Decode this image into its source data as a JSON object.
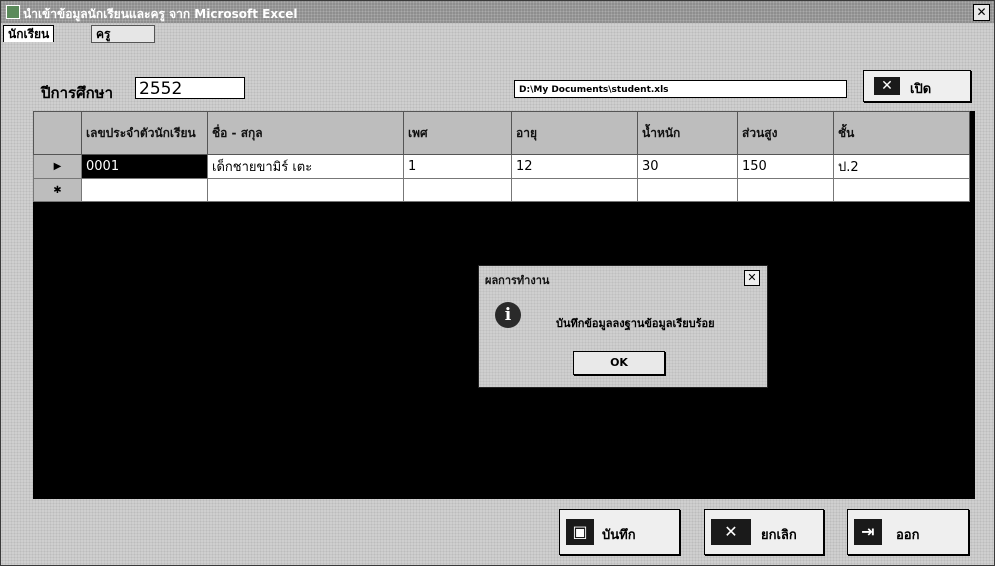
{
  "window": {
    "title": "นำเข้าข้อมูลนักเรียนและครู จาก Microsoft Excel",
    "close_symbol": "✕"
  },
  "tabs": [
    {
      "label": "นักเรียน",
      "active": true
    },
    {
      "label": "ครู",
      "active": false
    }
  ],
  "form": {
    "year_label": "ปีการศึกษา",
    "year_value": "2552",
    "file_path": "D:\\My Documents\\student.xls",
    "open_label": "เปิด",
    "excel_icon_glyph": "✕"
  },
  "grid": {
    "columns": [
      "เลขประจำตัวนักเรียน",
      "ชื่อ - สกุล",
      "เพศ",
      "อายุ",
      "น้ำหนัก",
      "ส่วนสูง",
      "ชั้น"
    ],
    "rows": [
      {
        "indicator": "▶",
        "cells": [
          "0001",
          "เด็กชายขามิร์  เตะ",
          "1",
          "12",
          "30",
          "150",
          "ป.2"
        ]
      },
      {
        "indicator": "✱",
        "cells": [
          "",
          "",
          "",
          "",
          "",
          "",
          ""
        ]
      }
    ]
  },
  "dialog": {
    "title": "ผลการทำงาน",
    "message": "บันทึกข้อมูลลงฐานข้อมูลเรียบร้อย",
    "ok_label": "OK",
    "close_symbol": "✕",
    "icon_glyph": "i"
  },
  "actions": {
    "save_label": "บันทึก",
    "cancel_label": "ยกเลิก",
    "exit_label": "ออก",
    "save_icon_glyph": "▣",
    "cancel_icon_glyph": "✕",
    "exit_icon_glyph": "⇥"
  },
  "colors": {
    "titlebar": "#8e8e8e",
    "window_bg": "#cfcfcf",
    "grid_bg": "#000000",
    "header_bg": "#bdbdbd"
  }
}
